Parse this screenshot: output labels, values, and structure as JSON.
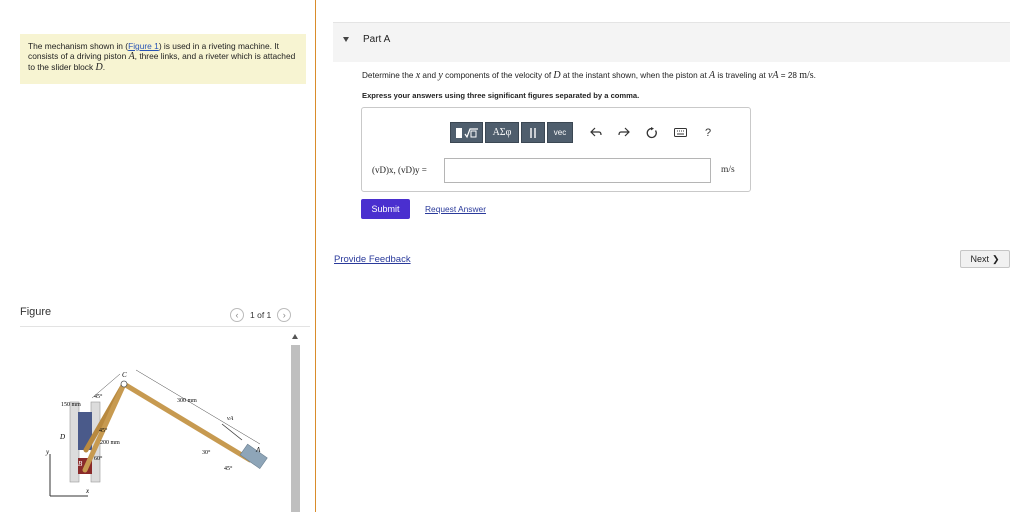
{
  "intro": {
    "text1": "The mechanism shown in (",
    "figure_link": "Figure 1",
    "text2": ") is used in a riveting machine. It consists of a driving piston ",
    "piston": "A",
    "text3": ", three links, and a riveter which is attached to the slider block ",
    "block": "D",
    "text4": "."
  },
  "figure_panel": {
    "label": "Figure",
    "page": "1 of 1",
    "dim_150": "150 mm",
    "dim_200": "200 mm",
    "dim_300": "300 mm",
    "angle_45a": "45°",
    "angle_45b": "45°",
    "angle_60": "60°",
    "angle_30": "30°",
    "angle_45c": "45°",
    "pt_c": "C",
    "pt_d": "D",
    "pt_b": "B",
    "pt_a": "A",
    "v_a": "vA",
    "axis_x": "x",
    "axis_y": "y"
  },
  "part": {
    "title": "Part A",
    "q1": "Determine the ",
    "qx": "x",
    "q2": " and ",
    "qy": "y",
    "q3": " components of the velocity of ",
    "qd": "D",
    "q4": " at the instant shown, when the piston at ",
    "qa": "A",
    "q5": " is traveling at ",
    "qva": "vA",
    "q6": " = 28 ",
    "qunit": "m/s",
    "q7": ".",
    "instruction": "Express your answers using three significant figures separated by a comma.",
    "toolbar": {
      "greek": "ΑΣφ",
      "vec": "vec",
      "help": "?"
    },
    "answer_label": "(vD)x, (vD)y =",
    "answer_value": "",
    "answer_unit": "m/s",
    "submit": "Submit",
    "request_answer": "Request Answer"
  },
  "footer": {
    "feedback": "Provide Feedback",
    "next": "Next"
  }
}
